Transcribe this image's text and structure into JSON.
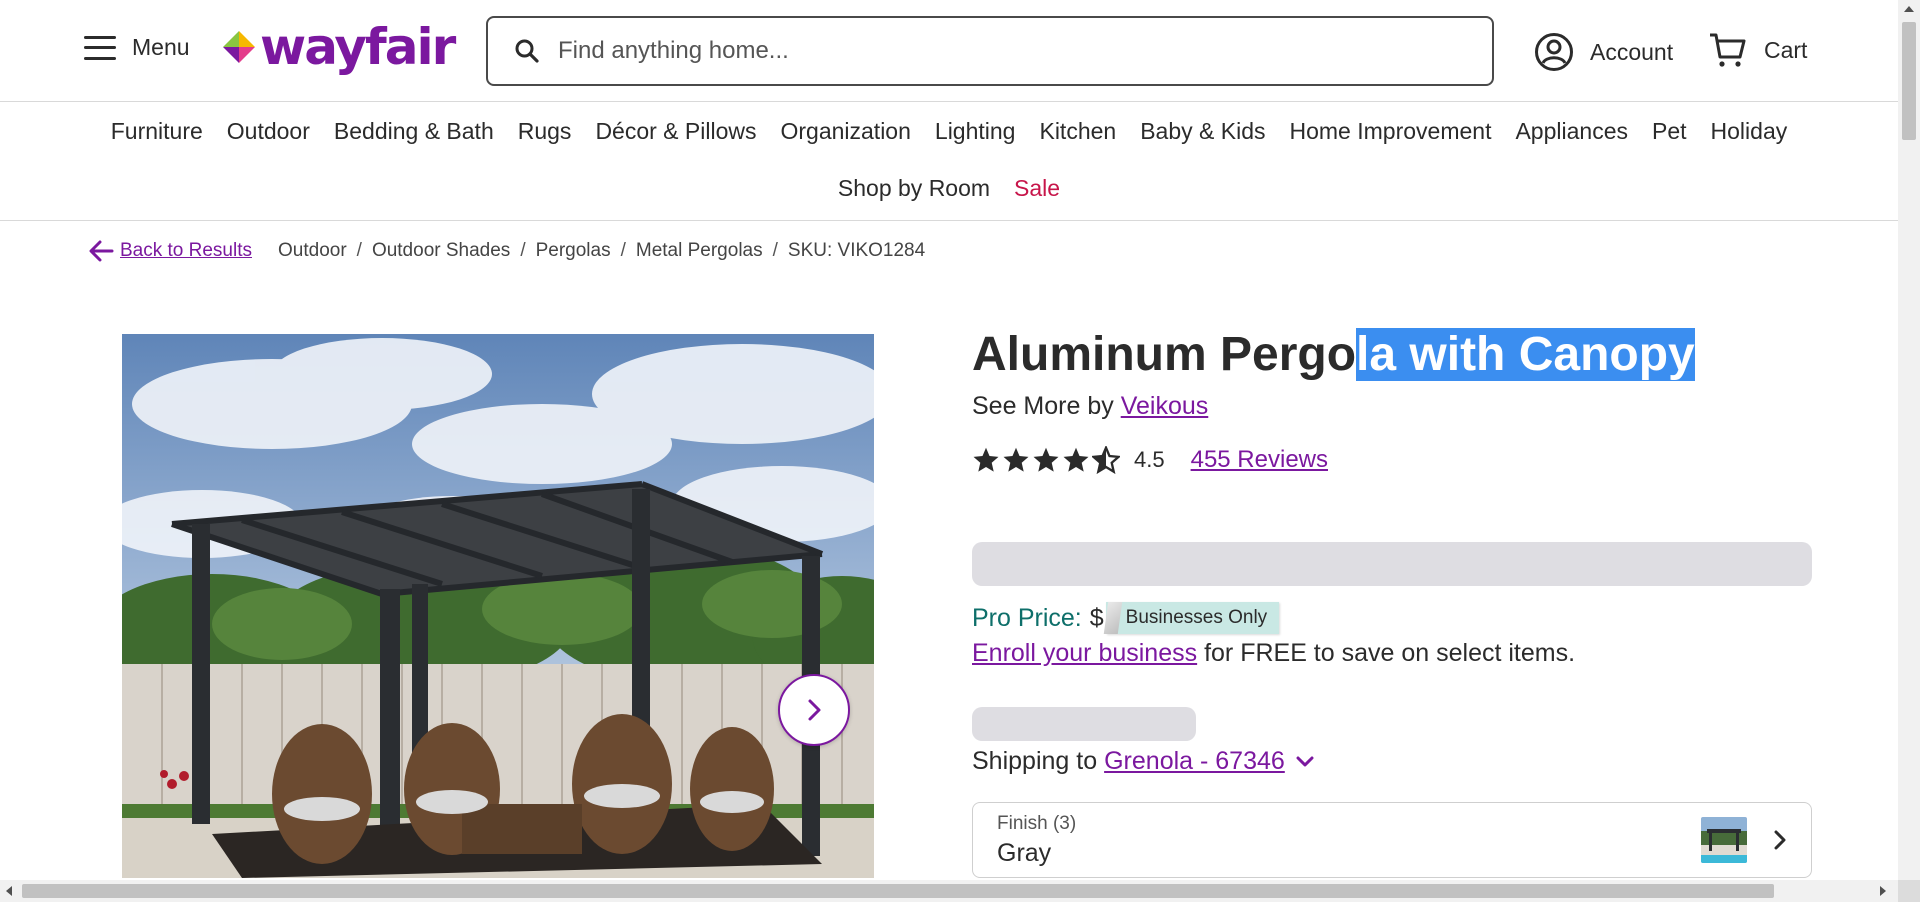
{
  "header": {
    "menu_label": "Menu",
    "logo_text": "wayfair",
    "search_placeholder": "Find anything home...",
    "account_label": "Account",
    "cart_label": "Cart",
    "brand_color": "#7b189f"
  },
  "nav": {
    "row1": [
      "Furniture",
      "Outdoor",
      "Bedding & Bath",
      "Rugs",
      "Décor & Pillows",
      "Organization",
      "Lighting",
      "Kitchen",
      "Baby & Kids",
      "Home Improvement",
      "Appliances",
      "Pet",
      "Holiday"
    ],
    "row2": [
      "Shop by Room",
      "Sale"
    ],
    "sale_color": "#c7154a"
  },
  "breadcrumb": {
    "back_label": "Back to Results",
    "items": [
      "Outdoor",
      "Outdoor Shades",
      "Pergolas",
      "Metal Pergolas"
    ],
    "sku": "SKU: VIKO1284"
  },
  "product": {
    "title_plain": "Aluminum Pergo",
    "title_selected": "la with Canopy",
    "selection_color": "#3b8ef0",
    "see_more_prefix": "See More by",
    "brand": "Veikous",
    "rating_value": "4.5",
    "rating_stars": 4.5,
    "reviews_label": "455 Reviews",
    "pro_price_label": "Pro Price:",
    "pro_price_dollar": "$",
    "pro_badge": "Businesses Only",
    "enroll_link": "Enroll your business",
    "enroll_rest": " for FREE to save on select items.",
    "shipping_prefix": "Shipping to",
    "shipping_location": "Grenola - 67346",
    "finish_label": "Finish (3)",
    "finish_value": "Gray"
  },
  "icons": [
    "menu-icon",
    "search-icon",
    "account-icon",
    "cart-icon",
    "arrow-left-icon",
    "chevron-right-icon",
    "chevron-down-icon",
    "star-icon"
  ]
}
